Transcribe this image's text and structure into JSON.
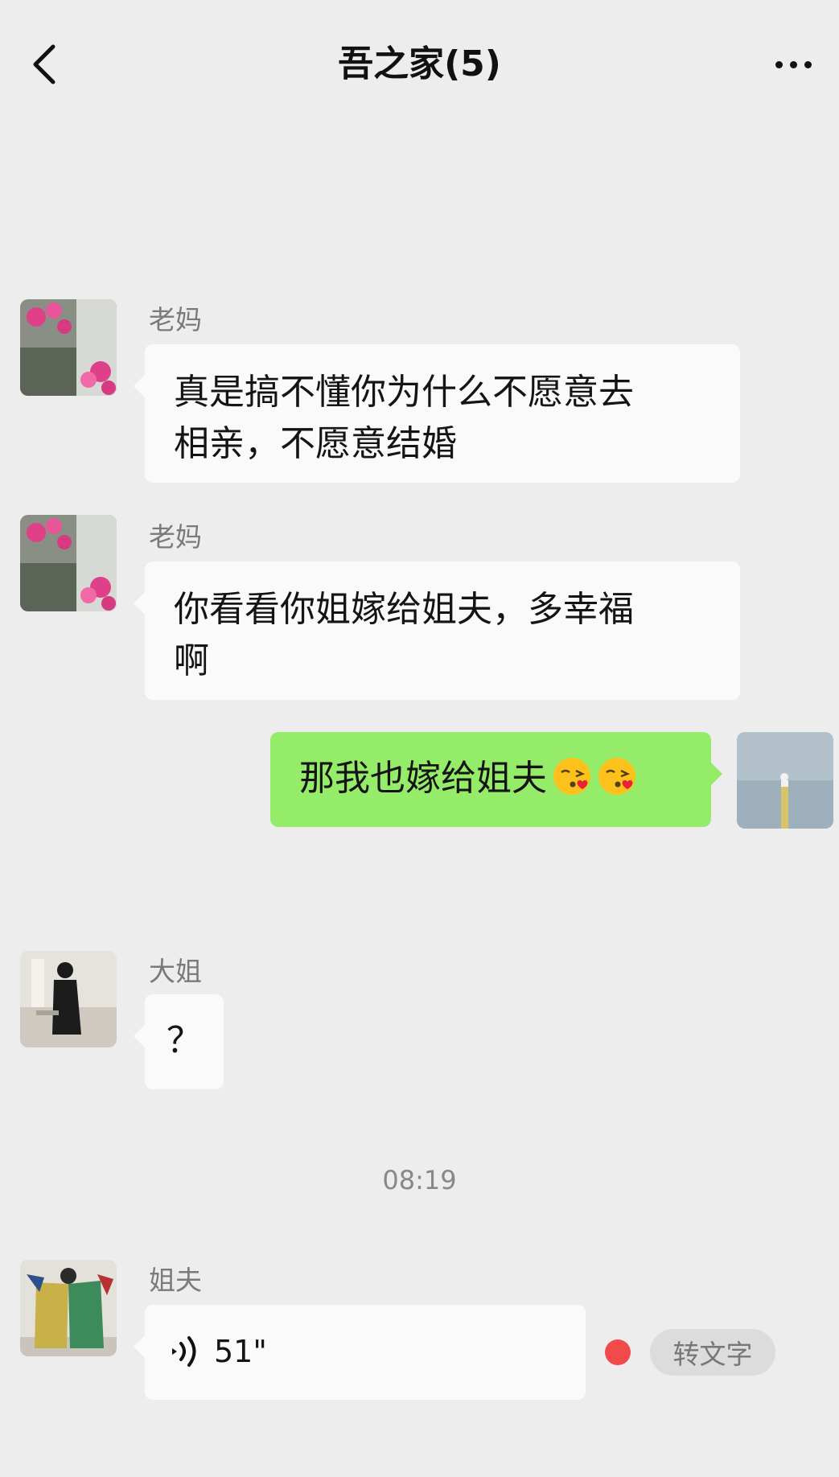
{
  "header": {
    "title": "吾之家(5)"
  },
  "messages": [
    {
      "sender": "老妈",
      "lines": [
        "真是搞不懂你为什么不愿意去",
        "相亲，不愿意结婚"
      ]
    },
    {
      "sender": "老妈",
      "lines": [
        "你看看你姐嫁给姐夫，多幸福",
        "啊"
      ]
    },
    {
      "text": "那我也嫁给姐夫",
      "emojis": [
        "kissing-face-emoji",
        "kissing-face-emoji"
      ]
    },
    {
      "sender": "大姐",
      "text": "？"
    },
    {
      "sender": "姐夫",
      "voice_duration": "51\"",
      "convert_label": "转文字"
    }
  ],
  "timestamp": "08:19",
  "colors": {
    "background": "#ededed",
    "incoming_bubble": "#fafafa",
    "outgoing_bubble": "#95ec69",
    "unread_dot": "#f04a4a"
  }
}
